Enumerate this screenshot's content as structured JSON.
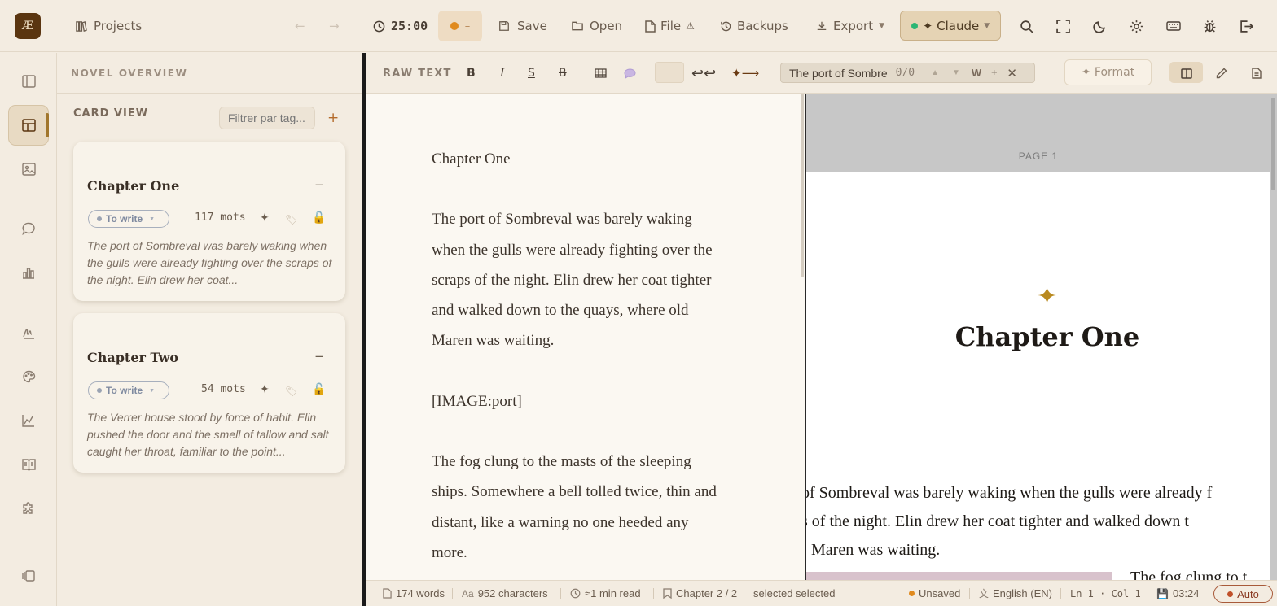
{
  "app": {
    "logo": "Æ"
  },
  "toolbar": {
    "projects": "Projects",
    "timer": "25:00",
    "pomodoro_value": "–",
    "save": "Save",
    "open": "Open",
    "file": "File",
    "file_warn": "⚠",
    "backups": "Backups",
    "export": "Export",
    "ai_model": "✦ Claude"
  },
  "overview": {
    "title": "NOVEL OVERVIEW",
    "card_view": "CARD VIEW",
    "filter_placeholder": "Filtrer par tag...",
    "add": "+",
    "cards": [
      {
        "title": "Chapter One",
        "status": "To write",
        "words": "117 mots",
        "excerpt": "The port of Sombreval was barely waking when the gulls were already fighting over the scraps of the night. Elin drew her coat..."
      },
      {
        "title": "Chapter Two",
        "status": "To write",
        "words": "54 mots",
        "excerpt": "The Verrer house stood by force of habit. Elin pushed the door and the smell of tallow and salt caught her throat, familiar to the point..."
      }
    ]
  },
  "editor": {
    "mode": "RAW TEXT",
    "bold": "B",
    "italic": "I",
    "underline": "S",
    "strike": "B",
    "search_value": "The port of Sombre",
    "search_count": "0/0",
    "search_w": "W",
    "search_pm": "±",
    "format": "✦ Format",
    "raw_paragraphs": [
      "Chapter One",
      "The port of Sombreval was barely waking when the gulls were already fighting over the scraps of the night. Elin drew her coat tighter and walked down to the quays, where old Maren was waiting.",
      "[IMAGE:port]",
      "The fog clung to the masts of the sleeping ships. Somewhere a bell tolled twice, thin and distant, like a warning no one heeded any more."
    ]
  },
  "preview": {
    "page_label": "PAGE 1",
    "ornament": "✦",
    "chapter_title": "Chapter One",
    "lines": [
      "of Sombreval was barely waking when the gulls were already f",
      "s of the night. Elin drew her coat tighter and walked down t",
      "Maren was waiting."
    ],
    "aside": "The fog clung to t"
  },
  "statusbar": {
    "words": "174 words",
    "characters": "952 characters",
    "read_time": "≈1 min read",
    "chapter": "Chapter 2 / 2",
    "selection": "selected  selected",
    "unsaved": "Unsaved",
    "language": "English (EN)",
    "cursor": "Ln 1 · Col 1",
    "time": "03:24",
    "auto": "Auto"
  },
  "colors": {
    "accent": "#a1762c",
    "brand": "#5a3510",
    "background": "#f3ece1",
    "status_pill": "#7f8aa0",
    "unsaved": "#e08a1e"
  }
}
